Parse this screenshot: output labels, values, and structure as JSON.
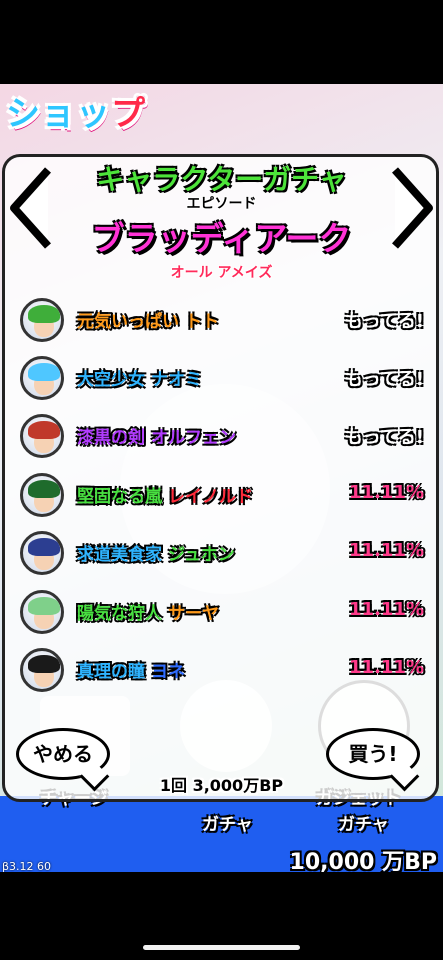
{
  "shop": {
    "title_a": "ショッ",
    "title_b": "プ"
  },
  "gacha": {
    "type_title": "キャラクターガチャ",
    "episode_label": "エピソード",
    "episode_name": "ブラッディアーク",
    "subtitle": "オール アメイズ"
  },
  "rows": [
    {
      "name_a": "元気いっぱい",
      "name_b": "トト",
      "status": "もってる!",
      "name_color": "#ff9a1a",
      "status_color": "#ffffff",
      "hair": "#3fae3a"
    },
    {
      "name_a": "大空少女",
      "name_b": "ナオミ",
      "status": "もってる!",
      "name_color": "#2fb4ff",
      "status_color": "#ffffff",
      "hair": "#4fc7ff"
    },
    {
      "name_a": "漆黒の剣",
      "name_b": "オルフェン",
      "status": "もってる!",
      "name_color": "#b23cff",
      "status_color": "#ffffff",
      "hair": "#c0392b"
    },
    {
      "name_a": "堅固なる嵐",
      "name_b": "レイノルド",
      "status": "11.11%",
      "name_color": "#48e040",
      "name_b_color": "#ff2a3a",
      "status_color": "#ff3a8a",
      "hair": "#1e6b2c"
    },
    {
      "name_a": "求道美食家",
      "name_b": "ジュホン",
      "status": "11.11%",
      "name_color": "#2fb4ff",
      "name_b_color": "#48e040",
      "status_color": "#ff3a8a",
      "hair": "#2c3e91"
    },
    {
      "name_a": "陽気な狩人",
      "name_b": "サーヤ",
      "status": "11.11%",
      "name_color": "#48e040",
      "name_b_color": "#ff9a1a",
      "status_color": "#ff3a8a",
      "hair": "#7fd08a"
    },
    {
      "name_a": "真理の瞳",
      "name_b": "ヨネ",
      "status": "11.11%",
      "name_color": "#2fb4ff",
      "name_b_color": "#2f6cff",
      "status_color": "#ff3a8a",
      "hair": "#1a1a1a"
    }
  ],
  "buttons": {
    "cancel": "やめる",
    "buy": "買う!"
  },
  "price": "1回 3,000万BP",
  "footer": {
    "gacha_left": "ガチャ",
    "gacha_right": "ガチャ",
    "charge": "チャージ",
    "gadget": "ガジェット",
    "bp_total": "10,000 万BP",
    "version": "β3.12 60"
  },
  "colors": {
    "bottom_bar": "#1f5ef0",
    "accent_pink": "#ff33d6",
    "accent_green": "#4de33a"
  }
}
